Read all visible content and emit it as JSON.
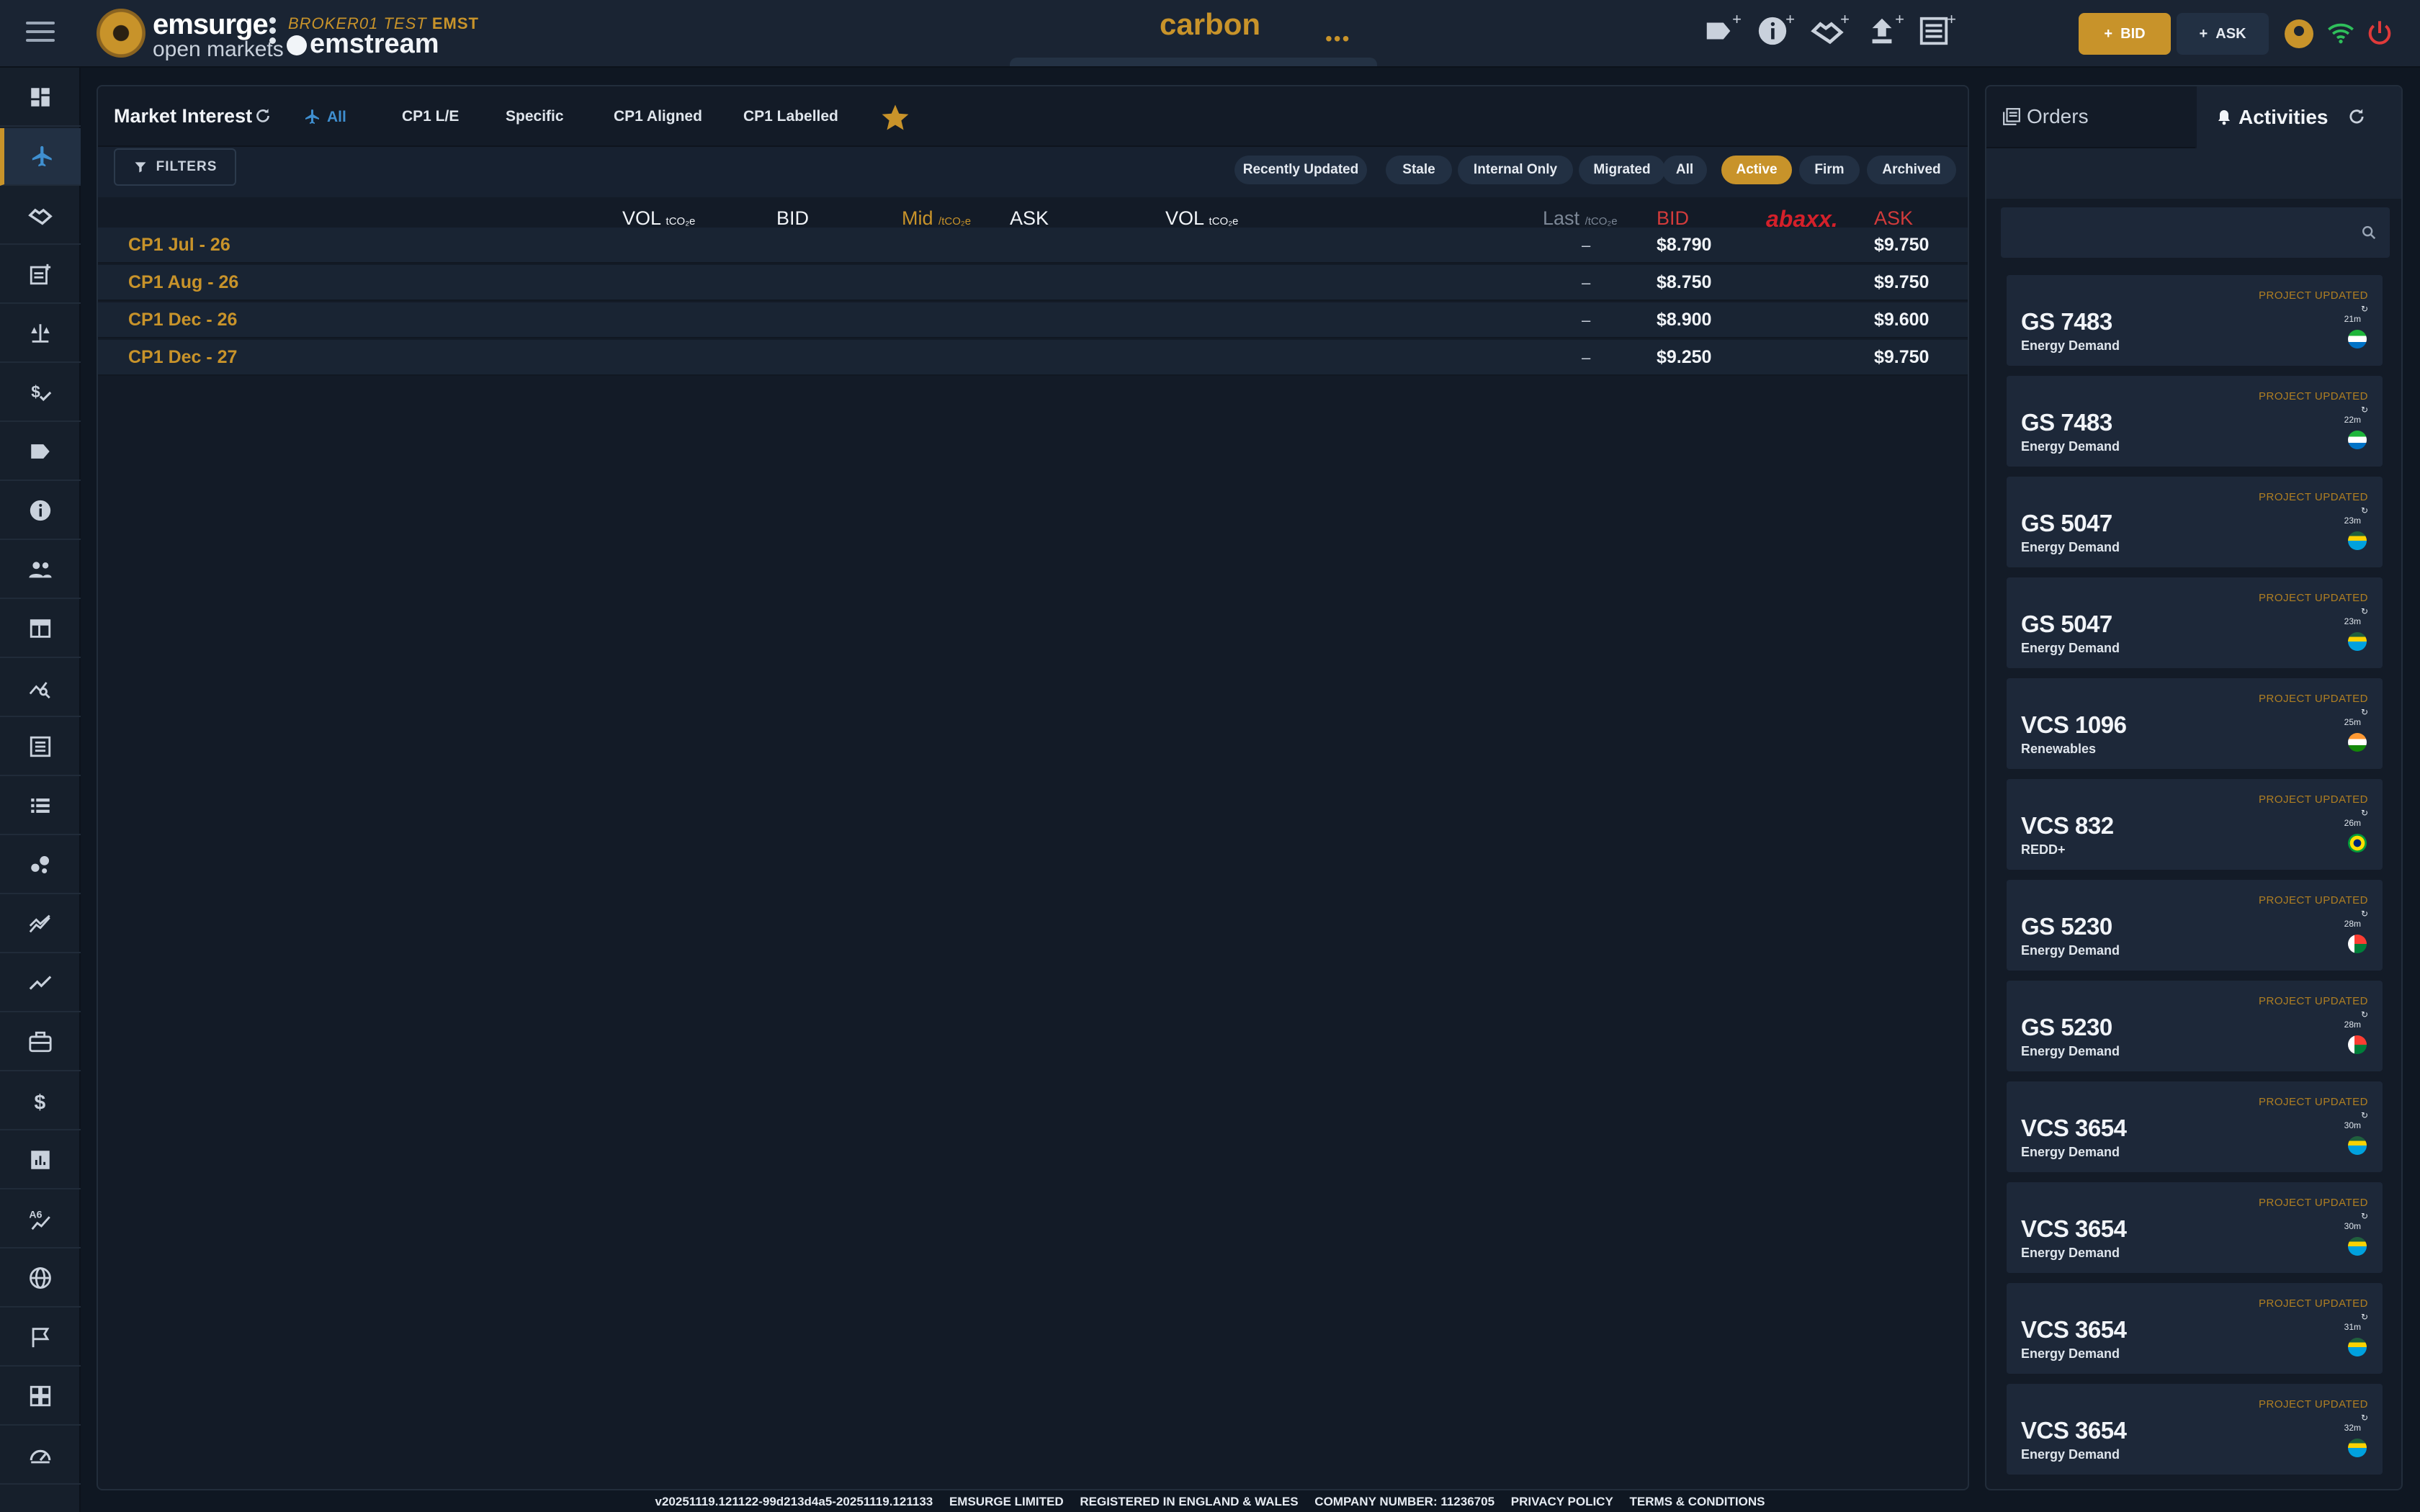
{
  "brand": {
    "name": "emsurge",
    "sub": "open markets",
    "broker_label": "BROKER01 TEST",
    "broker_code": "EMST",
    "stream_name": "emstream"
  },
  "header": {
    "product": "carbon",
    "more": "•••",
    "bid_label": "BID",
    "ask_label": "ASK",
    "plus": "+"
  },
  "market": {
    "title": "Market Interest",
    "tabs": [
      "All",
      "CP1 L/E",
      "Specific",
      "CP1 Aligned",
      "CP1 Labelled"
    ],
    "filters_label": "FILTERS",
    "chips": [
      "Recently Updated",
      "Stale",
      "Internal Only",
      "Migrated",
      "All",
      "Active",
      "Firm",
      "Archived"
    ],
    "active_chip": "Active",
    "columns": {
      "vol_bid": "VOL",
      "vol_unit": "tCO₂e",
      "bid": "BID",
      "mid": "Mid",
      "mid_unit": "/tCO₂e",
      "ask": "ASK",
      "vol_ask": "VOL",
      "last": "Last",
      "last_unit": "/tCO₂e",
      "bid2": "BID",
      "exchange": "abaxx.",
      "ask2": "ASK"
    },
    "rows": [
      {
        "name": "CP1 Jul - 26",
        "last": "–",
        "bid": "$8.790",
        "ask": "$9.750"
      },
      {
        "name": "CP1 Aug - 26",
        "last": "–",
        "bid": "$8.750",
        "ask": "$9.750"
      },
      {
        "name": "CP1 Dec - 26",
        "last": "–",
        "bid": "$8.900",
        "ask": "$9.600"
      },
      {
        "name": "CP1 Dec - 27",
        "last": "–",
        "bid": "$9.250",
        "ask": "$9.750"
      }
    ]
  },
  "activity_panel": {
    "tab_orders": "Orders",
    "tab_activities": "Activities",
    "search_placeholder": "",
    "items": [
      {
        "type": "PROJECT UPDATED",
        "name": "GS 7483",
        "category": "Energy Demand",
        "time": "21m",
        "flag": "sierra-leone"
      },
      {
        "type": "PROJECT UPDATED",
        "name": "GS 7483",
        "category": "Energy Demand",
        "time": "22m",
        "flag": "sierra-leone"
      },
      {
        "type": "PROJECT UPDATED",
        "name": "GS 5047",
        "category": "Energy Demand",
        "time": "23m",
        "flag": "rwanda"
      },
      {
        "type": "PROJECT UPDATED",
        "name": "GS 5047",
        "category": "Energy Demand",
        "time": "23m",
        "flag": "rwanda"
      },
      {
        "type": "PROJECT UPDATED",
        "name": "VCS 1096",
        "category": "Renewables",
        "time": "25m",
        "flag": "india"
      },
      {
        "type": "PROJECT UPDATED",
        "name": "VCS 832",
        "category": "REDD+",
        "time": "26m",
        "flag": "brazil"
      },
      {
        "type": "PROJECT UPDATED",
        "name": "GS 5230",
        "category": "Energy Demand",
        "time": "28m",
        "flag": "madagascar"
      },
      {
        "type": "PROJECT UPDATED",
        "name": "GS 5230",
        "category": "Energy Demand",
        "time": "28m",
        "flag": "madagascar"
      },
      {
        "type": "PROJECT UPDATED",
        "name": "VCS 3654",
        "category": "Energy Demand",
        "time": "30m",
        "flag": "rwanda"
      },
      {
        "type": "PROJECT UPDATED",
        "name": "VCS 3654",
        "category": "Energy Demand",
        "time": "30m",
        "flag": "rwanda"
      },
      {
        "type": "PROJECT UPDATED",
        "name": "VCS 3654",
        "category": "Energy Demand",
        "time": "31m",
        "flag": "rwanda"
      },
      {
        "type": "PROJECT UPDATED",
        "name": "VCS 3654",
        "category": "Energy Demand",
        "time": "32m",
        "flag": "rwanda"
      }
    ]
  },
  "footer": {
    "version": "v20251119.121122-99d213d4a5-20251119.121133",
    "company": "EMSURGE LIMITED",
    "registered": "REGISTERED IN ENGLAND & WALES",
    "company_number": "COMPANY NUMBER: 11236705",
    "privacy": "PRIVACY POLICY",
    "terms": "TERMS & CONDITIONS"
  },
  "sidebar_icons": [
    "dashboard-icon",
    "plane-icon",
    "handshake-icon",
    "post-add-icon",
    "balance-icon",
    "price-check-icon",
    "label-icon",
    "info-icon",
    "people-icon",
    "table-icon",
    "query-stats-icon",
    "list-alt-icon",
    "list-icon",
    "bubble-chart-icon",
    "multiline-chart-icon",
    "show-chart-icon",
    "briefcase-icon",
    "dollar-icon",
    "analytics-icon",
    "translate-icon",
    "globe-icon",
    "flag-icon",
    "apps-icon",
    "speed-icon"
  ],
  "colors": {
    "accent": "#c8932a",
    "background": "#0f1722",
    "panel": "#131b27",
    "link_active": "#3f8fd0",
    "exchange_red": "#d4202a"
  }
}
